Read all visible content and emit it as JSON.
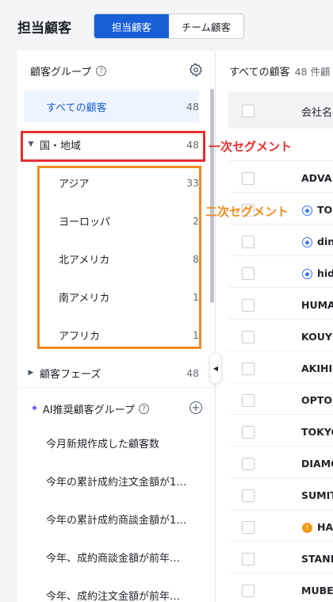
{
  "header": {
    "title": "担当顧客",
    "tabs": [
      "担当顧客",
      "チーム顧客"
    ]
  },
  "left": {
    "title": "顧客グループ",
    "all": {
      "label": "すべての顧客",
      "count": "48"
    },
    "region": {
      "label": "国・地域",
      "count": "48"
    },
    "regions": [
      {
        "label": "アジア",
        "count": "33"
      },
      {
        "label": "ヨーロッパ",
        "count": "2"
      },
      {
        "label": "北アメリカ",
        "count": "8"
      },
      {
        "label": "南アメリカ",
        "count": "1"
      },
      {
        "label": "アフリカ",
        "count": "1"
      }
    ],
    "phase": {
      "label": "顧客フェーズ",
      "count": "48"
    },
    "ai_title": "AI推奨顧客グループ",
    "ai_items": [
      "今月新規作成した顧客数",
      "今年の累計成約注文金額が1…",
      "今年の累計成約商談金額が1…",
      "今年、成約商談金額が前年…",
      "今年、成約注文金額が前年…"
    ]
  },
  "right": {
    "title": "すべての顧客",
    "count": "48 件顧",
    "column": "会社名",
    "rows": [
      {
        "name": "ADVA",
        "icon": ""
      },
      {
        "name": "TO",
        "icon": "blue"
      },
      {
        "name": "din",
        "icon": "blue"
      },
      {
        "name": "hid",
        "icon": "blue"
      },
      {
        "name": "HUMA",
        "icon": ""
      },
      {
        "name": "KOUY",
        "icon": ""
      },
      {
        "name": "AKIHI",
        "icon": ""
      },
      {
        "name": "OPTO",
        "icon": ""
      },
      {
        "name": "TOKYO",
        "icon": ""
      },
      {
        "name": "DIAMO",
        "icon": ""
      },
      {
        "name": "SUMIT",
        "icon": ""
      },
      {
        "name": "HA",
        "icon": "orange"
      },
      {
        "name": "STANI",
        "icon": ""
      },
      {
        "name": "MUBE",
        "icon": ""
      }
    ]
  },
  "annotations": {
    "primary": "一次セグメント",
    "secondary": "二次セグメント"
  },
  "colors": {
    "accent": "#1a5fd8",
    "red": "#e62e2e",
    "orange": "#f08a1f"
  }
}
